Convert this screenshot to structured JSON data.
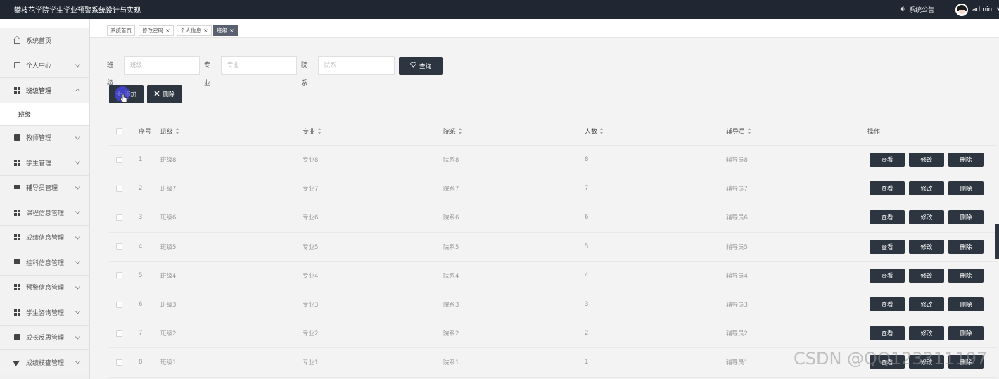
{
  "header": {
    "title": "攀枝花学院学生学业预警系统设计与实现",
    "notice_label": "系统公告",
    "username": "admin"
  },
  "sidebar": {
    "items": [
      {
        "label": "系统首页",
        "icon": "home-icon"
      },
      {
        "label": "个人中心",
        "icon": "box-icon"
      },
      {
        "label": "班级管理",
        "icon": "grid-icon",
        "open": true
      },
      {
        "label": "教师管理",
        "icon": "clipboard-icon"
      },
      {
        "label": "学生管理",
        "icon": "grid-icon"
      },
      {
        "label": "辅导员管理",
        "icon": "monitor-icon"
      },
      {
        "label": "课程信息管理",
        "icon": "grid-icon"
      },
      {
        "label": "成绩信息管理",
        "icon": "grid-icon"
      },
      {
        "label": "挂科信息管理",
        "icon": "monitor-icon"
      },
      {
        "label": "预警信息管理",
        "icon": "grid-icon"
      },
      {
        "label": "学生咨询管理",
        "icon": "grid-icon"
      },
      {
        "label": "成长反思管理",
        "icon": "chart-icon"
      },
      {
        "label": "成绩核查管理",
        "icon": "send-icon"
      }
    ],
    "submenu_label": "班级"
  },
  "tabs": [
    {
      "label": "系统首页",
      "closable": false
    },
    {
      "label": "修改密码",
      "closable": true
    },
    {
      "label": "个人信息",
      "closable": true
    },
    {
      "label": "班级",
      "closable": true,
      "active": true
    }
  ],
  "search": {
    "class_label": "班级",
    "class_placeholder": "班级",
    "major_label": "专业",
    "major_placeholder": "专业",
    "dept_label": "院系",
    "dept_placeholder": "院系",
    "query_button": "查询"
  },
  "actions": {
    "add": "添加",
    "delete": "删除"
  },
  "table": {
    "headers": {
      "index": "序号",
      "class": "班级",
      "major": "专业",
      "dept": "院系",
      "count": "人数",
      "counselor": "辅导员",
      "ops": "操作"
    },
    "rows": [
      {
        "index": "1",
        "class": "班级8",
        "major": "专业8",
        "dept": "院系8",
        "count": "8",
        "counselor": "辅导员8"
      },
      {
        "index": "2",
        "class": "班级7",
        "major": "专业7",
        "dept": "院系7",
        "count": "7",
        "counselor": "辅导员7"
      },
      {
        "index": "3",
        "class": "班级6",
        "major": "专业6",
        "dept": "院系6",
        "count": "6",
        "counselor": "辅导员6"
      },
      {
        "index": "4",
        "class": "班级5",
        "major": "专业5",
        "dept": "院系5",
        "count": "5",
        "counselor": "辅导员5"
      },
      {
        "index": "5",
        "class": "班级4",
        "major": "专业4",
        "dept": "院系4",
        "count": "4",
        "counselor": "辅导员4"
      },
      {
        "index": "6",
        "class": "班级3",
        "major": "专业3",
        "dept": "院系3",
        "count": "3",
        "counselor": "辅导员3"
      },
      {
        "index": "7",
        "class": "班级2",
        "major": "专业2",
        "dept": "院系2",
        "count": "2",
        "counselor": "辅导员2"
      },
      {
        "index": "8",
        "class": "班级1",
        "major": "专业1",
        "dept": "院系1",
        "count": "1",
        "counselor": "辅导员1"
      }
    ],
    "row_ops": {
      "view": "查看",
      "edit": "修改",
      "delete": "删除"
    }
  },
  "watermark": "CSDN @QQ123311197",
  "colors": {
    "header_bg": "#202733",
    "button_bg": "#2d3540",
    "page_bg": "#f3f3f3"
  }
}
